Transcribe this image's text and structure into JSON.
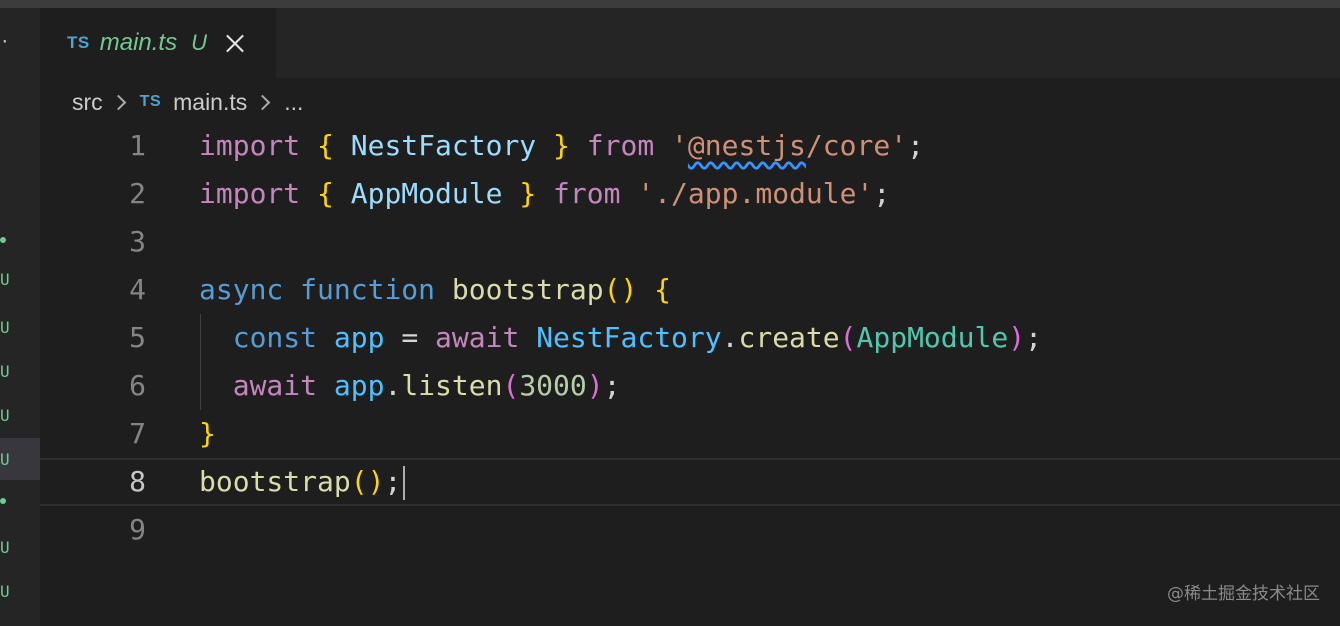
{
  "tab": {
    "badge": "TS",
    "filename": "main.ts",
    "status": "U"
  },
  "breadcrumb": {
    "folder": "src",
    "badge": "TS",
    "file": "main.ts",
    "more": "..."
  },
  "strip_marks": [
    "·",
    "U",
    "U",
    "U",
    "U",
    "U",
    "U",
    "U"
  ],
  "code": {
    "line_numbers": [
      "1",
      "2",
      "3",
      "4",
      "5",
      "6",
      "7",
      "8",
      "9"
    ],
    "current_line": 8
  },
  "watermark": "@稀土掘金技术社区",
  "colors": {
    "editor_bg": "#1e1e1e",
    "tab_bar": "#252526",
    "untracked": "#73c991",
    "ts_badge": "#4fa3d1"
  }
}
